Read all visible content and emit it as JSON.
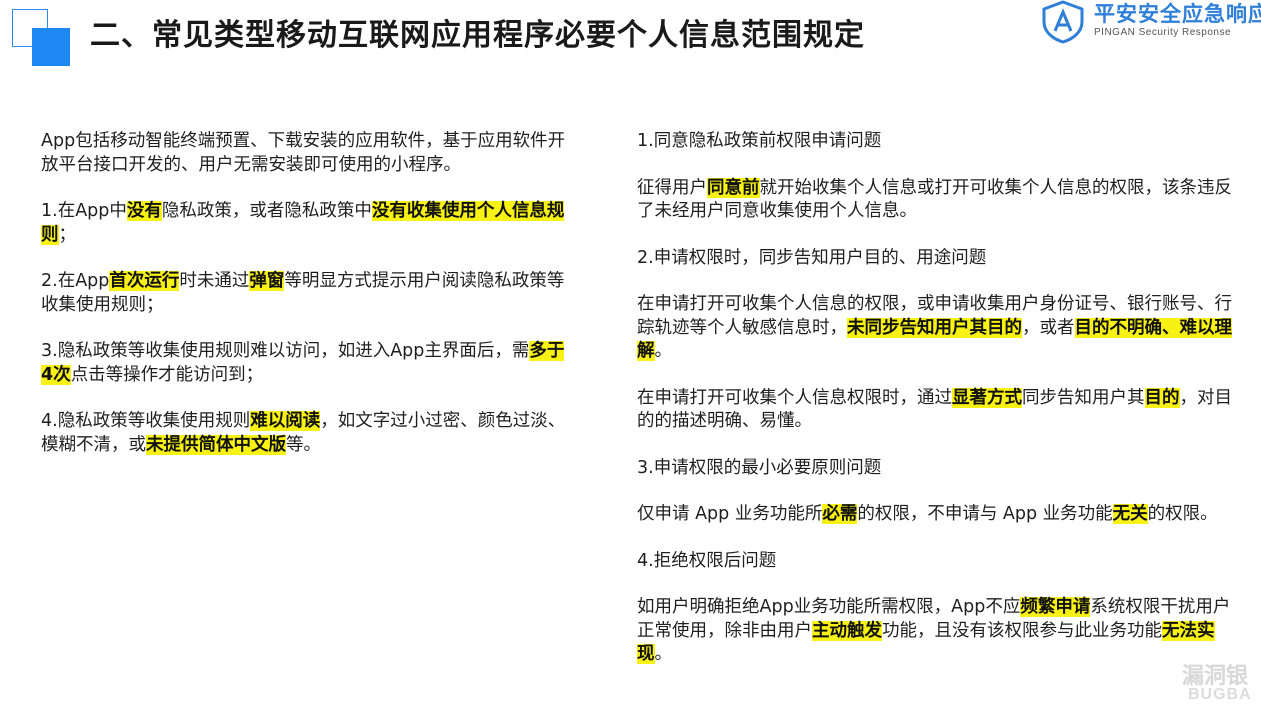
{
  "header": {
    "title": "二、常见类型移动互联网应用程序必要个人信息范围规定",
    "logo_cn": "平安安全应急响应",
    "logo_en": "PINGAN Security Response",
    "accent": "#1e88f2",
    "highlight": "#f8f214"
  },
  "left": [
    [
      {
        "t": "App包括移动智能终端预置、下载安装的应用软件，基于应用软件开放平台接口开发的、用户无需安装即可使用的小程序。"
      }
    ],
    [
      {
        "t": "1.在App中"
      },
      {
        "t": "没有",
        "h": true
      },
      {
        "t": "隐私政策，或者隐私政策中"
      },
      {
        "t": "没有收集使用个人信息规则",
        "h": true
      },
      {
        "t": "；"
      }
    ],
    [
      {
        "t": "2.在App"
      },
      {
        "t": "首次运行",
        "h": true
      },
      {
        "t": "时未通过"
      },
      {
        "t": "弹窗",
        "h": true
      },
      {
        "t": "等明显方式提示用户阅读隐私政策等收集使用规则；"
      }
    ],
    [
      {
        "t": "3.隐私政策等收集使用规则难以访问，如进入App主界面后，需"
      },
      {
        "t": "多于4次",
        "h": true
      },
      {
        "t": "点击等操作才能访问到；"
      }
    ],
    [
      {
        "t": "4.隐私政策等收集使用规则"
      },
      {
        "t": "难以阅读",
        "h": true
      },
      {
        "t": "，如文字过小过密、颜色过淡、模糊不清，或"
      },
      {
        "t": "未提供简体中文版",
        "h": true
      },
      {
        "t": "等。"
      }
    ]
  ],
  "right": [
    [
      {
        "t": "1.同意隐私政策前权限申请问题"
      }
    ],
    [
      {
        "t": "征得用户"
      },
      {
        "t": "同意前",
        "h": true
      },
      {
        "t": "就开始收集个人信息或打开可收集个人信息的权限，该条违反了未经用户同意收集使用个人信息。"
      }
    ],
    [
      {
        "t": "2.申请权限时，同步告知用户目的、用途问题"
      }
    ],
    [
      {
        "t": "在申请打开可收集个人信息的权限，或申请收集用户身份证号、银行账号、行踪轨迹等个人敏感信息时，"
      },
      {
        "t": "未同步告知用户其目的",
        "h": true
      },
      {
        "t": "，或者"
      },
      {
        "t": "目的不明确、难以理解",
        "h": true
      },
      {
        "t": "。"
      }
    ],
    [
      {
        "t": "在申请打开可收集个人信息权限时，通过"
      },
      {
        "t": "显著方式",
        "h": true
      },
      {
        "t": "同步告知用户其"
      },
      {
        "t": "目的",
        "h": true
      },
      {
        "t": "，对目的的描述明确、易懂。"
      }
    ],
    [
      {
        "t": "3.申请权限的最小必要原则问题"
      }
    ],
    [
      {
        "t": "仅申请 App 业务功能所"
      },
      {
        "t": "必需",
        "h": true
      },
      {
        "t": "的权限，不申请与 App 业务功能"
      },
      {
        "t": "无关",
        "h": true
      },
      {
        "t": "的权限。"
      }
    ],
    [
      {
        "t": "4.拒绝权限后问题"
      }
    ],
    [
      {
        "t": "如用户明确拒绝App业务功能所需权限，App不应"
      },
      {
        "t": "频繁申请",
        "h": true
      },
      {
        "t": "系统权限干扰用户正常使用，除非由用户"
      },
      {
        "t": "主动触发",
        "h": true
      },
      {
        "t": "功能，且没有该权限参与此业务功能"
      },
      {
        "t": "无法实现",
        "h": true
      },
      {
        "t": "。"
      }
    ]
  ],
  "watermark": {
    "cn": "漏洞银",
    "en": "BUGBA"
  }
}
